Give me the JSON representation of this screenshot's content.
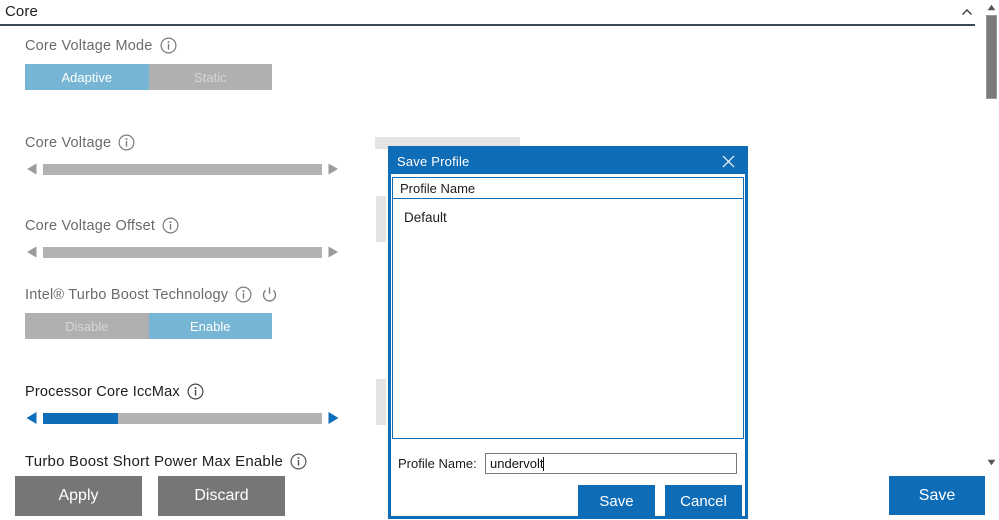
{
  "header": {
    "title": "Core",
    "collapse_icon": "chevron-up-icon"
  },
  "scrollbar": {
    "up_icon": "scroll-up-arrow-icon",
    "down_icon": "scroll-down-arrow-icon"
  },
  "controls": [
    {
      "label": "Core Voltage Mode",
      "info_icon": "info-icon",
      "type": "segmented",
      "options": [
        "Adaptive",
        "Static"
      ],
      "selected": "Adaptive"
    },
    {
      "label": "Core Voltage",
      "info_icon": "info-icon",
      "type": "slider",
      "fill_percent": 0
    },
    {
      "label": "Core Voltage Offset",
      "info_icon": "info-icon",
      "type": "slider",
      "fill_percent": 0
    },
    {
      "label": "Intel® Turbo Boost Technology",
      "info_icon": "info-icon",
      "power_icon": "power-icon",
      "type": "segmented",
      "options": [
        "Disable",
        "Enable"
      ],
      "selected": "Enable"
    },
    {
      "label": "Processor Core IccMax",
      "info_icon": "info-icon",
      "type": "slider",
      "fill_percent": 27
    },
    {
      "label": "Turbo Boost Short Power Max Enable",
      "info_icon": "info-icon",
      "type": "label-only"
    }
  ],
  "actions": {
    "apply_label": "Apply",
    "discard_label": "Discard",
    "save_label": "Save"
  },
  "dialog": {
    "title": "Save Profile",
    "close_icon": "close-icon",
    "list_header": "Profile Name",
    "list_items": [
      "Default"
    ],
    "name_field_label": "Profile Name:",
    "name_field_value": "undervolt",
    "save_label": "Save",
    "cancel_label": "Cancel"
  },
  "colors": {
    "accent_blue": "#0f6cb6",
    "toggle_selected": "#76b5d3",
    "toggle_unselected": "#b0b0b0",
    "button_gray": "#767676",
    "slider_track": "#b2b2b2"
  }
}
